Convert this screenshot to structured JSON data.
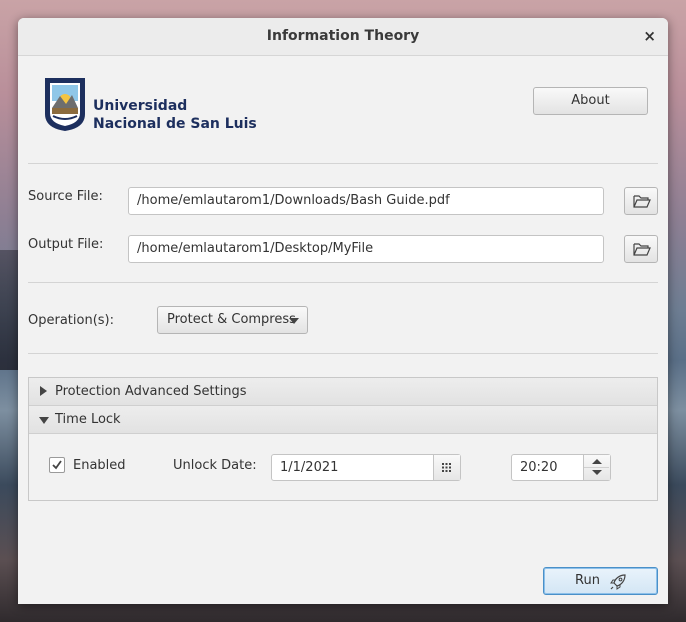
{
  "window": {
    "title": "Information Theory",
    "close_glyph": "×"
  },
  "logo": {
    "line1": "Universidad",
    "line2": "Nacional de San Luis",
    "icon": "university-shield-logo"
  },
  "buttons": {
    "about": "About",
    "run": "Run"
  },
  "source": {
    "label": "Source File:",
    "value": "/home/emlautarom1/Downloads/Bash Guide.pdf",
    "browse_icon": "folder-open-icon"
  },
  "output": {
    "label": "Output File:",
    "value": "/home/emlautarom1/Desktop/MyFile",
    "browse_icon": "folder-open-icon"
  },
  "operation": {
    "label": "Operation(s):",
    "selected": "Protect & Compress"
  },
  "accordion": {
    "protection": {
      "label": "Protection Advanced Settings",
      "expanded": false
    },
    "timelock": {
      "label": "Time Lock",
      "expanded": true
    }
  },
  "timelock": {
    "enabled_label": "Enabled",
    "enabled": true,
    "unlock_label": "Unlock Date:",
    "date": "1/1/2021",
    "time": "20:20"
  },
  "colors": {
    "logo_navy": "#1d2f5e",
    "run_accent": "#4a90c8"
  }
}
